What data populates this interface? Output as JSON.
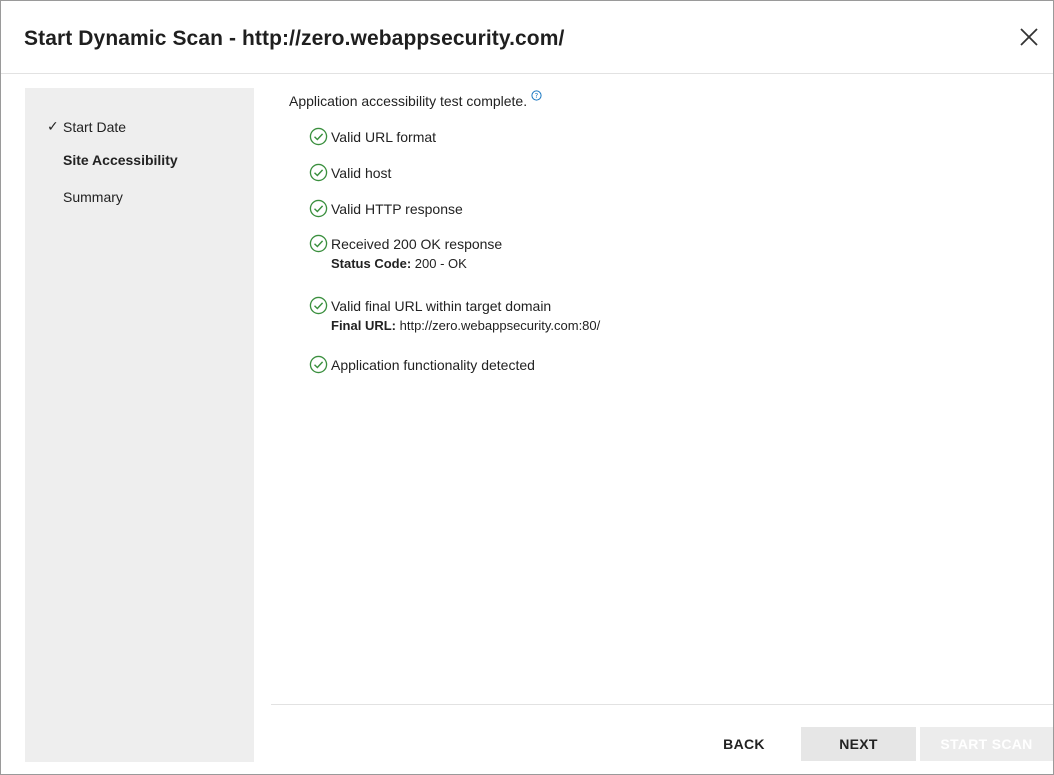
{
  "dialog": {
    "title": "Start Dynamic Scan - http://zero.webappsecurity.com/"
  },
  "sidebar": {
    "steps": [
      {
        "label": "Start Date",
        "completed": true
      },
      {
        "label": "Site Accessibility",
        "active": true
      },
      {
        "label": "Summary"
      }
    ],
    "check_glyph": "✓"
  },
  "main": {
    "intro": "Application accessibility test complete.",
    "checks": [
      {
        "label": "Valid URL format"
      },
      {
        "label": "Valid host"
      },
      {
        "label": "Valid HTTP response"
      },
      {
        "label": "Received 200 OK response",
        "detail_label": "Status Code:",
        "detail_value": " 200 - OK"
      },
      {
        "label": "Valid final URL within target domain",
        "detail_label": "Final URL:",
        "detail_value": " http://zero.webappsecurity.com:80/"
      },
      {
        "label": "Application functionality detected"
      }
    ]
  },
  "footer": {
    "back_label": "BACK",
    "next_label": "NEXT",
    "start_label": "START SCAN"
  },
  "colors": {
    "ok_green": "#3a8f3e",
    "help_blue": "#1a78c2",
    "sidebar_bg": "#eeeeee",
    "next_bg": "#e6e6e6",
    "start_disabled_bg": "#ececec"
  },
  "icons": {
    "close": "close-icon",
    "help": "help-icon",
    "ok": "check-circle-icon"
  }
}
